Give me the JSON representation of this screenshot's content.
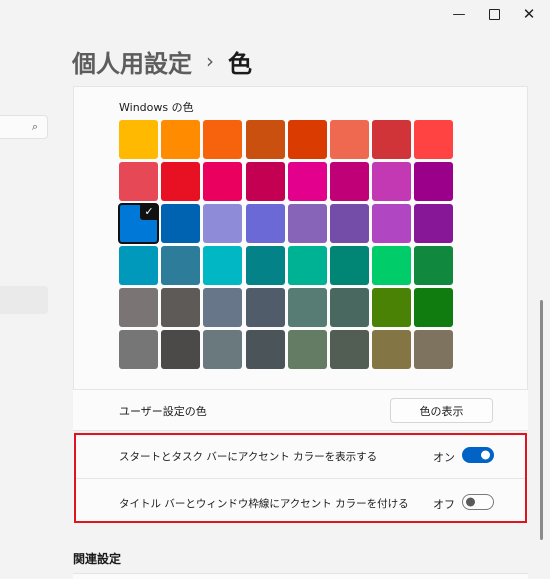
{
  "window": {
    "minimize_glyph": "—",
    "close_glyph": "✕"
  },
  "search": {
    "icon": "search-icon",
    "glyph": "🔍"
  },
  "breadcrumb": {
    "parent": "個人用設定",
    "separator": "›",
    "current": "色"
  },
  "windows_colors": {
    "label": "Windows の色",
    "selected_index": 16,
    "check_glyph": "✓",
    "swatches": [
      "#ffb900",
      "#ff8c00",
      "#f7630c",
      "#ca5010",
      "#da3b01",
      "#ef6950",
      "#d13438",
      "#ff4343",
      "#e74856",
      "#e81123",
      "#ea005e",
      "#c30052",
      "#e3008c",
      "#bf0077",
      "#c239b3",
      "#9a0089",
      "#0078d7",
      "#0063b1",
      "#8e8cd8",
      "#6b69d6",
      "#8764b8",
      "#744da9",
      "#b146c2",
      "#881798",
      "#0099bc",
      "#2d7d9a",
      "#00b7c3",
      "#038387",
      "#00b294",
      "#018574",
      "#00cc6a",
      "#10893e",
      "#7a7574",
      "#5d5a58",
      "#68768a",
      "#515c6b",
      "#567c73",
      "#486860",
      "#498205",
      "#107c10",
      "#767676",
      "#4c4a48",
      "#69797e",
      "#4a5459",
      "#647c64",
      "#525e54",
      "#847545",
      "#7e735f"
    ]
  },
  "custom_color": {
    "label": "ユーザー設定の色",
    "button_label": "色の表示"
  },
  "toggles": [
    {
      "label": "スタートとタスク バーにアクセント カラーを表示する",
      "state_label": "オン",
      "on": true
    },
    {
      "label": "タイトル バーとウィンドウ枠線にアクセント カラーを付ける",
      "state_label": "オフ",
      "on": false
    }
  ],
  "related": {
    "title": "関連設定"
  },
  "colors": {
    "accent": "#0063c5",
    "highlight_frame": "#e0141e"
  }
}
